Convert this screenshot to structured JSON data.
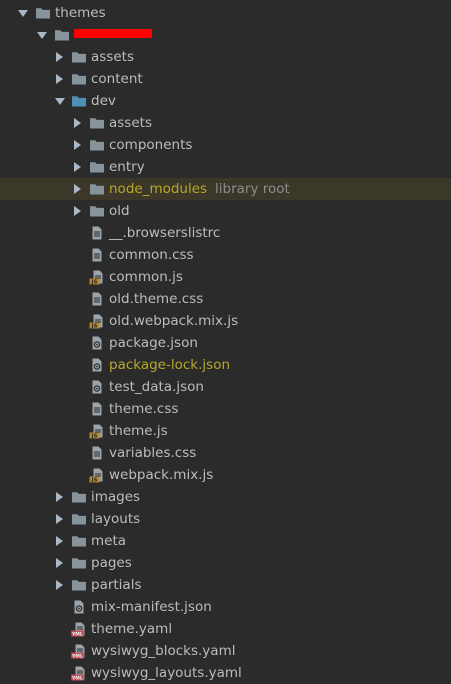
{
  "colors": {
    "background": "#2b2b2b",
    "text": "#bbbdbd",
    "folder": "#87939a",
    "folder_dev": "#4d90b2",
    "highlight_row": "#3b3829",
    "highlight_text": "#b8a72a",
    "js_badge": "#b5862e",
    "yml_badge": "#c0505a"
  },
  "tree": {
    "root": {
      "label": "themes",
      "icon": "folder-icon"
    },
    "theme": {
      "label": "",
      "icon": "folder-icon",
      "redacted": true
    },
    "theme_children": {
      "assets": "assets",
      "content": "content",
      "dev": "dev",
      "images": "images",
      "layouts": "layouts",
      "meta": "meta",
      "pages": "pages",
      "partials": "partials",
      "mix_manifest": "mix-manifest.json",
      "theme_yaml": "theme.yaml",
      "wysiwyg_blocks": "wysiwyg_blocks.yaml",
      "wysiwyg_layouts": "wysiwyg_layouts.yaml"
    },
    "dev_children": {
      "assets": "assets",
      "components": "components",
      "entry": "entry",
      "node_modules": "node_modules",
      "node_modules_suffix": "library root",
      "old": "old",
      "browserslistrc": "__.browserslistrc",
      "common_css": "common.css",
      "common_js": "common.js",
      "old_theme_css": "old.theme.css",
      "old_webpack": "old.webpack.mix.js",
      "package_json": "package.json",
      "package_lock": "package-lock.json",
      "test_data": "test_data.json",
      "theme_css": "theme.css",
      "theme_js": "theme.js",
      "variables_css": "variables.css",
      "webpack_mix": "webpack.mix.js"
    }
  }
}
